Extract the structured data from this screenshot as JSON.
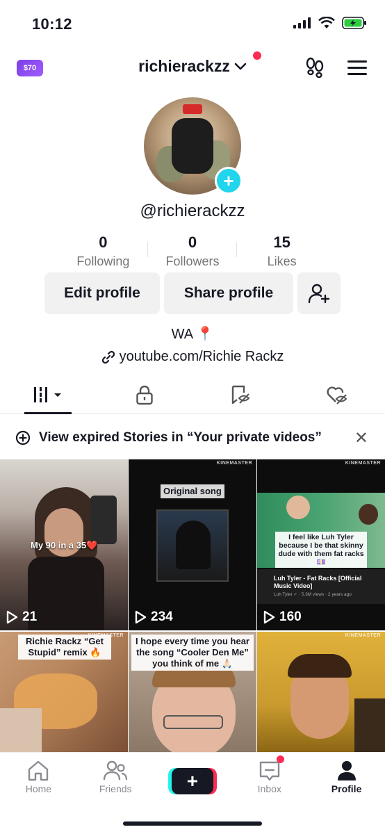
{
  "status_bar": {
    "time": "10:12"
  },
  "top_nav": {
    "coins": "$70",
    "username": "richierackzz"
  },
  "profile": {
    "handle": "@richierackzz",
    "stats": [
      {
        "value": "0",
        "label": "Following"
      },
      {
        "value": "0",
        "label": "Followers"
      },
      {
        "value": "15",
        "label": "Likes"
      }
    ],
    "edit_label": "Edit profile",
    "share_label": "Share profile",
    "location": "WA 📍",
    "link": "youtube.com/Richie Rackz"
  },
  "stories_banner": {
    "text": "View expired Stories in “Your private videos”"
  },
  "videos": [
    {
      "views": "21",
      "caption": "My 90 in a 35❤️",
      "bg": "#6e5a52"
    },
    {
      "views": "234",
      "caption": "Original song",
      "bg": "#101010"
    },
    {
      "views": "160",
      "caption": "I feel like Luh Tyler because I be that skinny dude with them fat racks 💷",
      "yt_title": "Luh Tyler - Fat Racks [Official Music Video]",
      "yt_meta": "Luh Tyler ✓ · 5.3M views · 2 years ago",
      "bg": "#3c7a5a"
    },
    {
      "views": "",
      "caption": "Richie Rackz “Get Stupid” remix 🔥",
      "bg": "#b8865e"
    },
    {
      "views": "",
      "caption": "I hope every time you hear the song “Cooler Den Me” you think of me 🙏🏻",
      "bg": "#8a7766"
    },
    {
      "views": "",
      "caption": "",
      "bg": "#c99a2e"
    }
  ],
  "tab_bar": {
    "items": [
      {
        "label": "Home",
        "icon": "home-icon"
      },
      {
        "label": "Friends",
        "icon": "friends-icon"
      },
      {
        "label": "",
        "icon": "create-icon"
      },
      {
        "label": "Inbox",
        "icon": "inbox-icon"
      },
      {
        "label": "Profile",
        "icon": "profile-icon"
      }
    ]
  },
  "colors": {
    "accent_red": "#fe2c55",
    "accent_cyan": "#20d5ec"
  }
}
